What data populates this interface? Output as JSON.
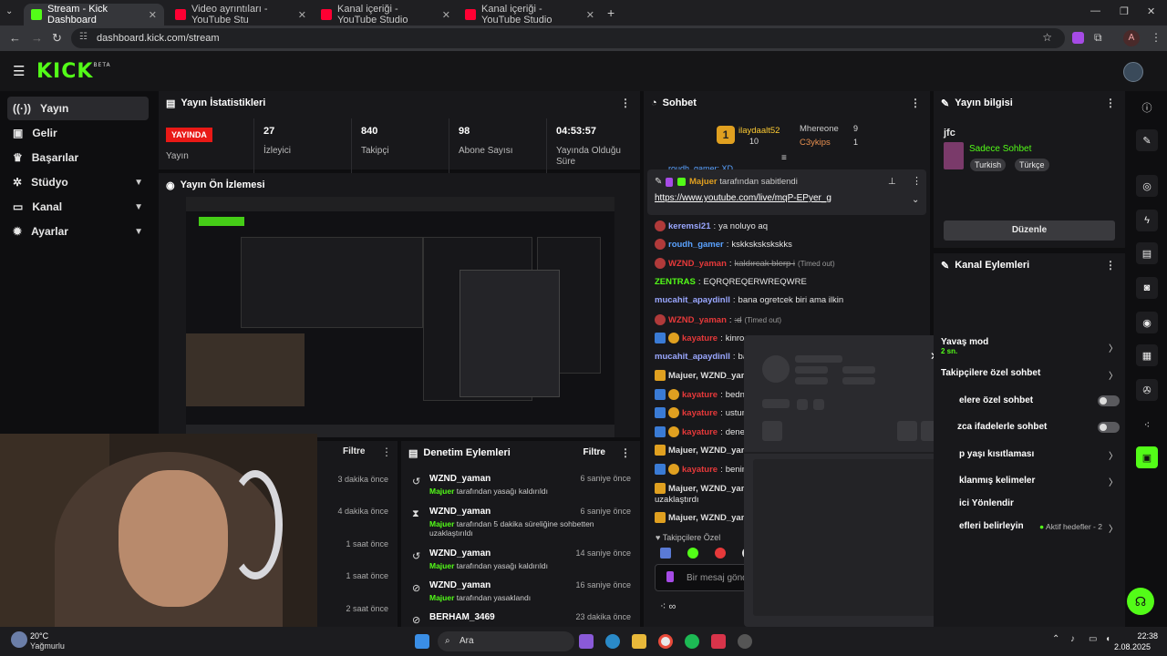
{
  "browser": {
    "tabs": [
      {
        "label": "Stream - Kick Dashboard",
        "active": true
      },
      {
        "label": "Video ayrıntıları - YouTube Stu"
      },
      {
        "label": "Kanal içeriği - YouTube Studio"
      },
      {
        "label": "Kanal içeriği - YouTube Studio"
      }
    ],
    "url": "dashboard.kick.com/stream",
    "profile_initial": "A"
  },
  "app": {
    "logo": "KICK",
    "logo_sup": "BETA"
  },
  "sidebar": {
    "items": [
      {
        "label": "Yayın",
        "icon": "broadcast-icon",
        "active": true
      },
      {
        "label": "Gelir",
        "icon": "wallet-icon"
      },
      {
        "label": "Başarılar",
        "icon": "trophy-icon"
      },
      {
        "label": "Stüdyo",
        "icon": "gear-icon",
        "chevron": true
      },
      {
        "label": "Kanal",
        "icon": "monitor-icon",
        "chevron": true
      },
      {
        "label": "Ayarlar",
        "icon": "settings-icon",
        "chevron": true
      }
    ]
  },
  "stats": {
    "title": "Yayın İstatistikleri",
    "live_badge": "YAYINDA",
    "live_label": "Yayın",
    "items": [
      {
        "value": "27",
        "label": "İzleyici"
      },
      {
        "value": "840",
        "label": "Takipçi"
      },
      {
        "value": "98",
        "label": "Abone Sayısı"
      },
      {
        "value": "04:53:57",
        "label": "Yayında Olduğu Süre"
      }
    ]
  },
  "preview": {
    "title": "Yayın Ön İzlemesi"
  },
  "left_activity": {
    "filter": "Filtre",
    "times": [
      "3 dakika önce",
      "4 dakika önce",
      "1 saat önce",
      "1 saat önce",
      "2 saat önce"
    ]
  },
  "moderation": {
    "title": "Denetim Eylemleri",
    "filter": "Filtre",
    "rows": [
      {
        "icon": "unban-icon",
        "glyph": "↺",
        "name": "WZND_yaman",
        "time": "6 saniye önce",
        "by": "Majuer",
        "desc": "tarafından yasağı kaldırıldı"
      },
      {
        "icon": "hourglass-icon",
        "glyph": "⧗",
        "name": "WZND_yaman",
        "time": "6 saniye önce",
        "by": "Majuer",
        "desc": "tarafından 5 dakika süreliğine sohbetten uzaklaştırıldı"
      },
      {
        "icon": "unban-icon",
        "glyph": "↺",
        "name": "WZND_yaman",
        "time": "14 saniye önce",
        "by": "Majuer",
        "desc": "tarafından yasağı kaldırıldı"
      },
      {
        "icon": "ban-icon",
        "glyph": "⊘",
        "name": "WZND_yaman",
        "time": "16 saniye önce",
        "by": "Majuer",
        "desc": "tarafından yasaklandı"
      },
      {
        "icon": "ban-icon",
        "glyph": "⊘",
        "name": "BERHAM_3469",
        "time": "23 dakika önce",
        "by": "",
        "desc": ""
      }
    ]
  },
  "chat": {
    "title": "Sohbet",
    "top": [
      {
        "name": "ilaydaalt52",
        "count": "10"
      },
      {
        "name": "Mhereone",
        "count": "9"
      },
      {
        "name": "C3ykips",
        "count": "1"
      }
    ],
    "pinned_by": "Majuer",
    "pinned_text": "tarafından sabitlendi",
    "pinned_link": "https://www.youtube.com/live/mqP-EPyer_g",
    "scroll_peek": "roudh_gamer: XD",
    "messages": [
      {
        "user": "keremsi21",
        "text": "ya noluyo aq",
        "color": "#9aa7ff"
      },
      {
        "user": "roudh_gamer",
        "text": "kskkskskskskks",
        "color": "#5aa2ff"
      },
      {
        "user": "WZND_yaman",
        "text": "kaldırcak blerp i",
        "note": "(Timed out)",
        "color": "#e6393a"
      },
      {
        "user": "ZENTRAS",
        "text": "EQRQREQERWREQWRE",
        "color": "#53fc18"
      },
      {
        "user": "mucahit_apaydinll",
        "text": "bana ogretcek biri ama ilkin",
        "color": "#9aa7ff"
      },
      {
        "user": "WZND_yaman",
        "text": ":d",
        "note": "(Timed out)",
        "color": "#e6393a"
      },
      {
        "user": "kayature",
        "text": "kinros",
        "color": "#e6393a"
      },
      {
        "user": "mucahit_apaydinll",
        "text": "ban",
        "color": "#9aa7ff"
      },
      {
        "user": "Majuer, WZND_yaman",
        "text": "",
        "color": "#dddddd"
      },
      {
        "user": "kayature",
        "text": "bednr",
        "color": "#e6393a"
      },
      {
        "user": "kayature",
        "text": "ustum",
        "color": "#e6393a"
      },
      {
        "user": "kayature",
        "text": "dene",
        "color": "#e6393a"
      },
      {
        "user": "Majuer, WZND_yaman",
        "text": "",
        "color": "#dddddd"
      },
      {
        "user": "kayature",
        "text": "benim",
        "color": "#e6393a"
      },
      {
        "user": "Majuer, WZND_yaman",
        "text": "uzaklaştırdı",
        "color": "#dddddd"
      },
      {
        "user": "Majuer, WZND_yaman",
        "text": "",
        "color": "#dddddd"
      }
    ],
    "followers_only": "Takipçilere Özel",
    "input_placeholder": "Bir mesaj gönd"
  },
  "stream_info": {
    "title": "Yayın bilgisi",
    "stream_title": "jfc",
    "category": "Sadece Sohbet",
    "tags": [
      "Turkish",
      "Türkçe"
    ],
    "edit": "Düzenle"
  },
  "channel_actions": {
    "title": "Kanal Eylemleri",
    "slow_mode": "Yavaş mod",
    "slow_value": "2 sn.",
    "followers_chat": "Takipçilere özel sohbet",
    "subs_chat": "elere özel sohbet",
    "emote_chat": "zca ifadelerle sohbet",
    "age_limit": "p yaşı kısıtlaması",
    "banned_words": "klanmış kelimeler",
    "redirect": "ici Yönlendir",
    "goals": "efleri belirleyin",
    "goals_status": "Aktif hedefler - 2"
  },
  "taskbar": {
    "weather_temp": "20°C",
    "weather_desc": "Yağmurlu",
    "search": "Ara",
    "time": "22:38",
    "date": "2.08.2025"
  }
}
